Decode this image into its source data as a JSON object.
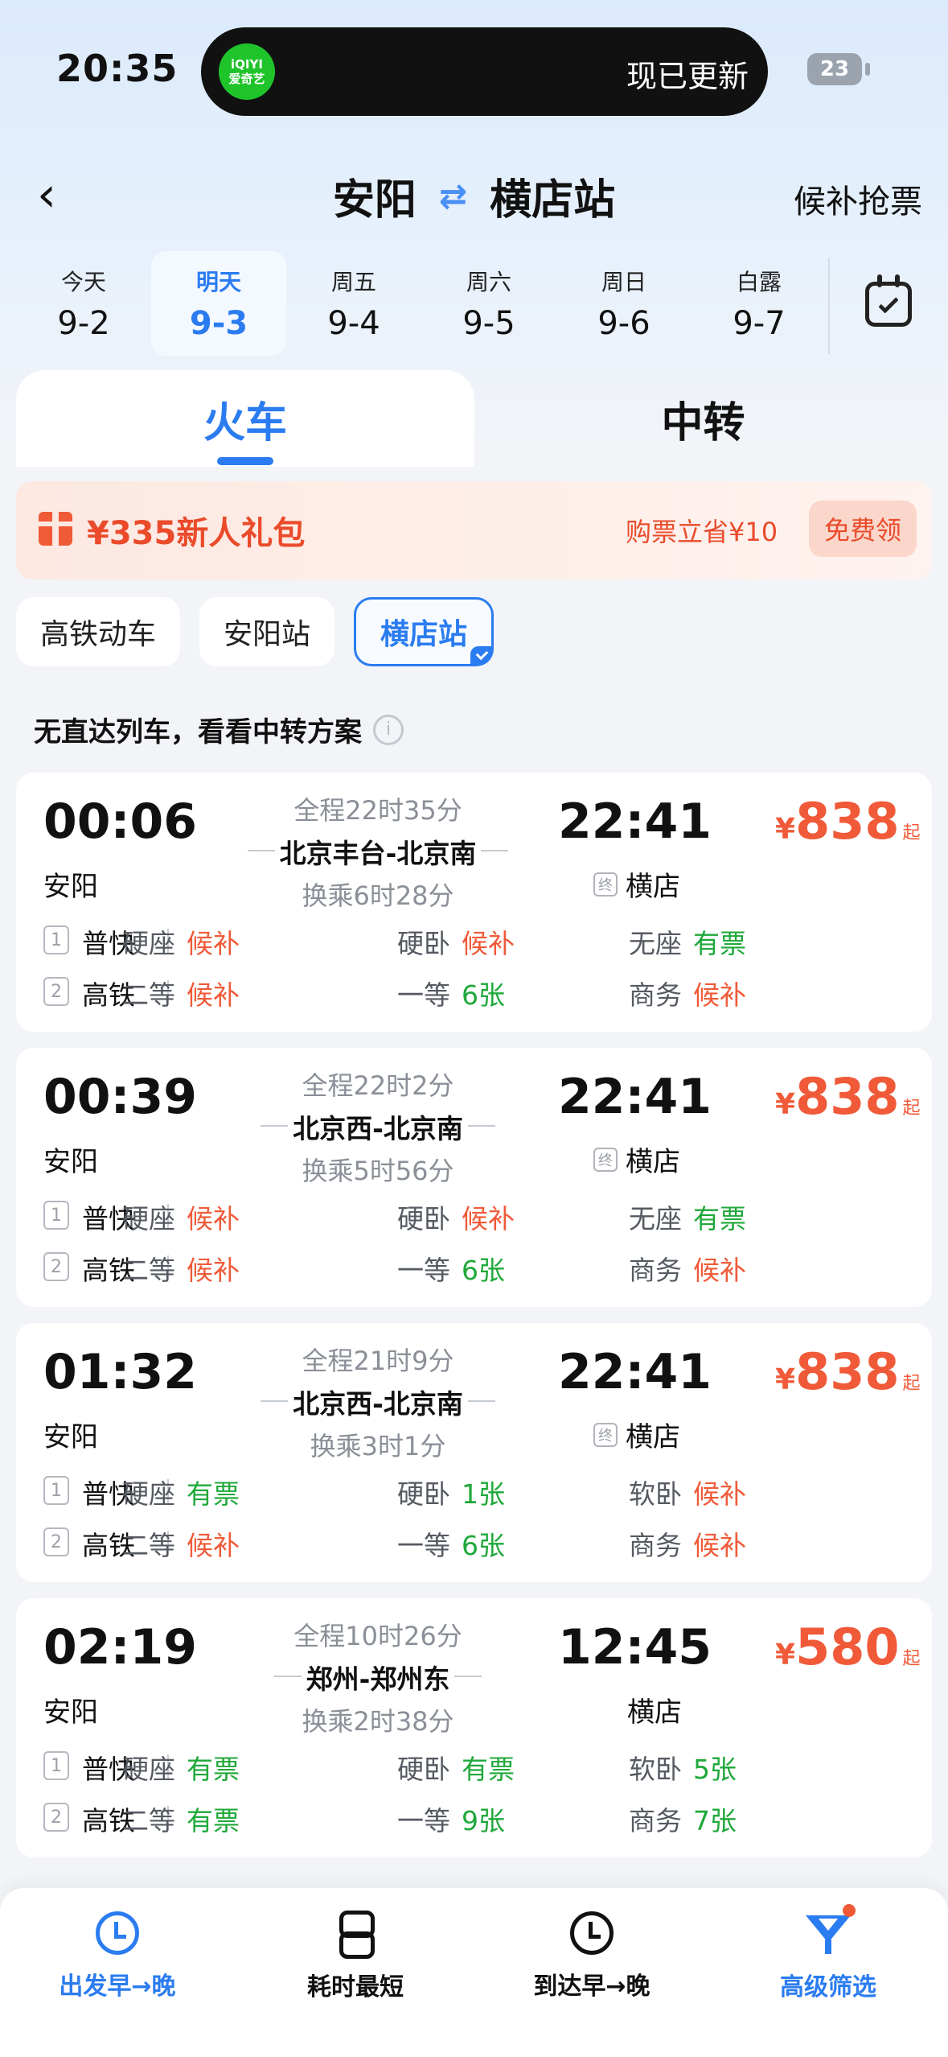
{
  "status_bar": {
    "time": "20:35",
    "island_app": "iQIYI",
    "island_app_sub": "爱奇艺",
    "island_text": "现已更新",
    "battery": "23"
  },
  "header": {
    "from": "安阳",
    "to": "横店站",
    "right_action": "候补抢票"
  },
  "dates": [
    {
      "weekday": "今天",
      "date": "9-2",
      "selected": false
    },
    {
      "weekday": "明天",
      "date": "9-3",
      "selected": true
    },
    {
      "weekday": "周五",
      "date": "9-4",
      "selected": false
    },
    {
      "weekday": "周六",
      "date": "9-5",
      "selected": false
    },
    {
      "weekday": "周日",
      "date": "9-6",
      "selected": false
    },
    {
      "weekday": "白露",
      "date": "9-7",
      "selected": false
    }
  ],
  "tabs": {
    "train": "火车",
    "transfer": "中转"
  },
  "promo": {
    "title": "¥335新人礼包",
    "save": "购票立省¥10",
    "button": "免费领"
  },
  "filters": [
    "高铁动车",
    "安阳站",
    "横店站"
  ],
  "notice": "无直达列车，看看中转方案",
  "results": [
    {
      "depart": "00:06",
      "from": "安阳",
      "total": "全程22时35分",
      "via": "北京丰台-北京南",
      "transfer": "换乘6时28分",
      "arrive": "22:41",
      "to": "横店",
      "terminal": "终",
      "currency": "¥",
      "price": "838",
      "price_suffix": "起",
      "segments": [
        {
          "idx": "1",
          "type": "普快",
          "seats": [
            {
              "n": "硬座",
              "v": "候补",
              "c": "red"
            },
            {
              "n": "硬卧",
              "v": "候补",
              "c": "red"
            },
            {
              "n": "无座",
              "v": "有票",
              "c": "green"
            }
          ]
        },
        {
          "idx": "2",
          "type": "高铁",
          "seats": [
            {
              "n": "二等",
              "v": "候补",
              "c": "red"
            },
            {
              "n": "一等",
              "v": "6张",
              "c": "green"
            },
            {
              "n": "商务",
              "v": "候补",
              "c": "red"
            }
          ]
        }
      ]
    },
    {
      "depart": "00:39",
      "from": "安阳",
      "total": "全程22时2分",
      "via": "北京西-北京南",
      "transfer": "换乘5时56分",
      "arrive": "22:41",
      "to": "横店",
      "terminal": "终",
      "currency": "¥",
      "price": "838",
      "price_suffix": "起",
      "segments": [
        {
          "idx": "1",
          "type": "普快",
          "seats": [
            {
              "n": "硬座",
              "v": "候补",
              "c": "red"
            },
            {
              "n": "硬卧",
              "v": "候补",
              "c": "red"
            },
            {
              "n": "无座",
              "v": "有票",
              "c": "green"
            }
          ]
        },
        {
          "idx": "2",
          "type": "高铁",
          "seats": [
            {
              "n": "二等",
              "v": "候补",
              "c": "red"
            },
            {
              "n": "一等",
              "v": "6张",
              "c": "green"
            },
            {
              "n": "商务",
              "v": "候补",
              "c": "red"
            }
          ]
        }
      ]
    },
    {
      "depart": "01:32",
      "from": "安阳",
      "total": "全程21时9分",
      "via": "北京西-北京南",
      "transfer": "换乘3时1分",
      "arrive": "22:41",
      "to": "横店",
      "terminal": "终",
      "currency": "¥",
      "price": "838",
      "price_suffix": "起",
      "segments": [
        {
          "idx": "1",
          "type": "普快",
          "seats": [
            {
              "n": "硬座",
              "v": "有票",
              "c": "green"
            },
            {
              "n": "硬卧",
              "v": "1张",
              "c": "green"
            },
            {
              "n": "软卧",
              "v": "候补",
              "c": "red"
            }
          ]
        },
        {
          "idx": "2",
          "type": "高铁",
          "seats": [
            {
              "n": "二等",
              "v": "候补",
              "c": "red"
            },
            {
              "n": "一等",
              "v": "6张",
              "c": "green"
            },
            {
              "n": "商务",
              "v": "候补",
              "c": "red"
            }
          ]
        }
      ]
    },
    {
      "depart": "02:19",
      "from": "安阳",
      "total": "全程10时26分",
      "via": "郑州-郑州东",
      "transfer": "换乘2时38分",
      "arrive": "12:45",
      "to": "横店",
      "terminal": "",
      "currency": "¥",
      "price": "580",
      "price_suffix": "起",
      "segments": [
        {
          "idx": "1",
          "type": "普快",
          "seats": [
            {
              "n": "硬座",
              "v": "有票",
              "c": "green"
            },
            {
              "n": "硬卧",
              "v": "有票",
              "c": "green"
            },
            {
              "n": "软卧",
              "v": "5张",
              "c": "green"
            }
          ]
        },
        {
          "idx": "2",
          "type": "高铁",
          "seats": [
            {
              "n": "二等",
              "v": "有票",
              "c": "green"
            },
            {
              "n": "一等",
              "v": "9张",
              "c": "green"
            },
            {
              "n": "商务",
              "v": "7张",
              "c": "green"
            }
          ]
        }
      ]
    }
  ],
  "bottom_bar": [
    {
      "label": "出发早→晚",
      "icon": "clock-icon",
      "active": true
    },
    {
      "label": "耗时最短",
      "icon": "hourglass-icon",
      "active": false
    },
    {
      "label": "到达早→晚",
      "icon": "clock-icon",
      "active": false
    },
    {
      "label": "高级筛选",
      "icon": "filter-icon",
      "active": true
    }
  ],
  "colors": {
    "accent": "#2b7cf0",
    "price": "#f05a38",
    "available": "#1fa83a"
  }
}
